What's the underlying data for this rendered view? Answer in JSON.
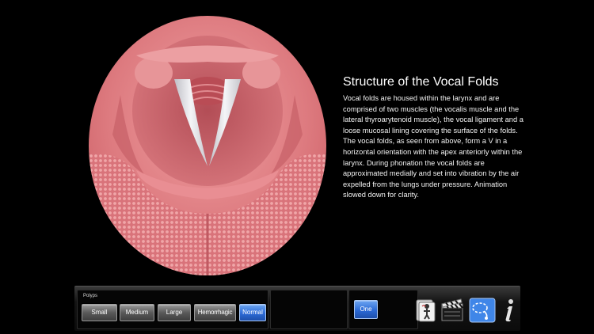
{
  "info": {
    "title": "Structure of the Vocal Folds",
    "body": "Vocal folds are housed within the larynx and are comprised of two muscles (the vocalis muscle and the lateral thyroarytenoid muscle), the vocal ligament and a loose mucosal lining covering the surface of the folds. The vocal folds, as seen from above, form a V in a horizontal orientation with the apex anteriorly within the larynx. During phonation the vocal folds are approximated medially and set into vibration by the air expelled from the lungs under pressure. Animation slowed down for clarity."
  },
  "toolbar": {
    "polyps_label": "Polyps",
    "buttons": {
      "small": "Small",
      "medium": "Medium",
      "large": "Large",
      "hemorrhagic": "Hemorrhagic",
      "normal": "Normal"
    },
    "selected_polyp": "Normal",
    "count_button": "One"
  },
  "icons": {
    "anatomy": "anatomy-icon",
    "video": "clapperboard-icon",
    "lasso": "lasso-icon",
    "info": "info-icon"
  },
  "colors": {
    "active_button": "#2c6ad6",
    "tissue": "#d9777c",
    "vocal_folds": "#e6e6ea"
  }
}
